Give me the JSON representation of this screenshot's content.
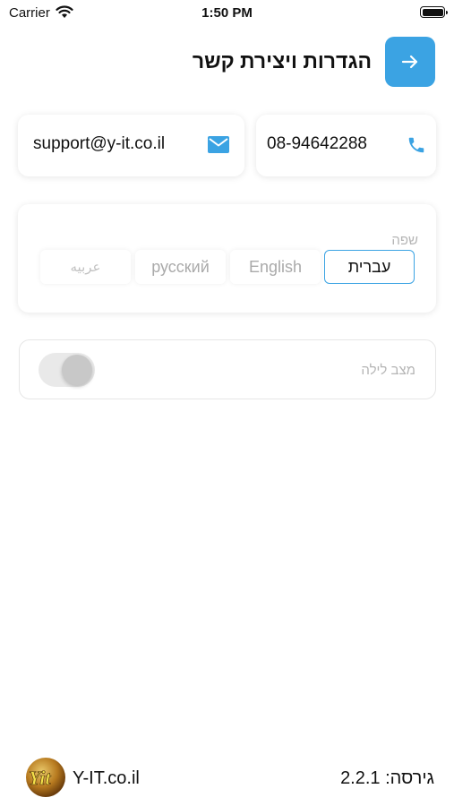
{
  "status_bar": {
    "carrier": "Carrier",
    "time": "1:50 PM"
  },
  "header": {
    "title": "הגדרות ויצירת קשר",
    "back_icon": "arrow-right-icon",
    "accent_color": "#3ba3e3"
  },
  "contact": {
    "email": "support@y-it.co.il",
    "email_icon": "envelope-icon",
    "phone": "08-94642288",
    "phone_icon": "phone-icon"
  },
  "language": {
    "label": "שפה",
    "options": [
      "עברית",
      "English",
      "русский",
      "عربيه"
    ],
    "selected": "עברית"
  },
  "night_mode": {
    "label": "מצב לילה",
    "enabled": false
  },
  "footer": {
    "logo_text": "Yit",
    "site": "Y-IT.co.il",
    "version": "גירסה: 2.2.1"
  }
}
